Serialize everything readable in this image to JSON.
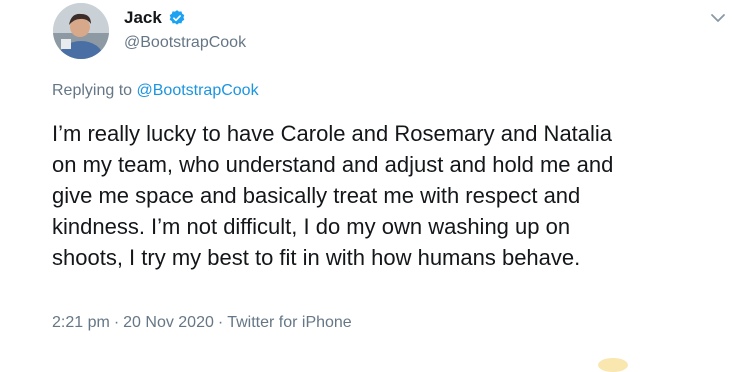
{
  "tweet": {
    "display_name": "Jack",
    "handle": "@BootstrapCook",
    "reply_prefix": "Replying to ",
    "reply_handle": "@BootstrapCook",
    "lines": [
      "I’m really lucky to have Carole and Rosemary and Natalia",
      "on my team, who understand and adjust and hold me and",
      "give me space and basically treat me with respect and",
      "kindness. I’m not difficult, I do my own washing up on",
      "shoots, I try my best to fit in with how humans behave."
    ],
    "time": "2:21 pm",
    "separator": "·",
    "date": "20 Nov 2020",
    "source": "Twitter for iPhone"
  },
  "icons": {
    "verified": "verified-badge-icon",
    "more": "chevron-down-icon"
  },
  "colors": {
    "text": "#14171a",
    "secondary": "#657786",
    "link": "#1b95e0",
    "verified": "#1da1f2"
  }
}
